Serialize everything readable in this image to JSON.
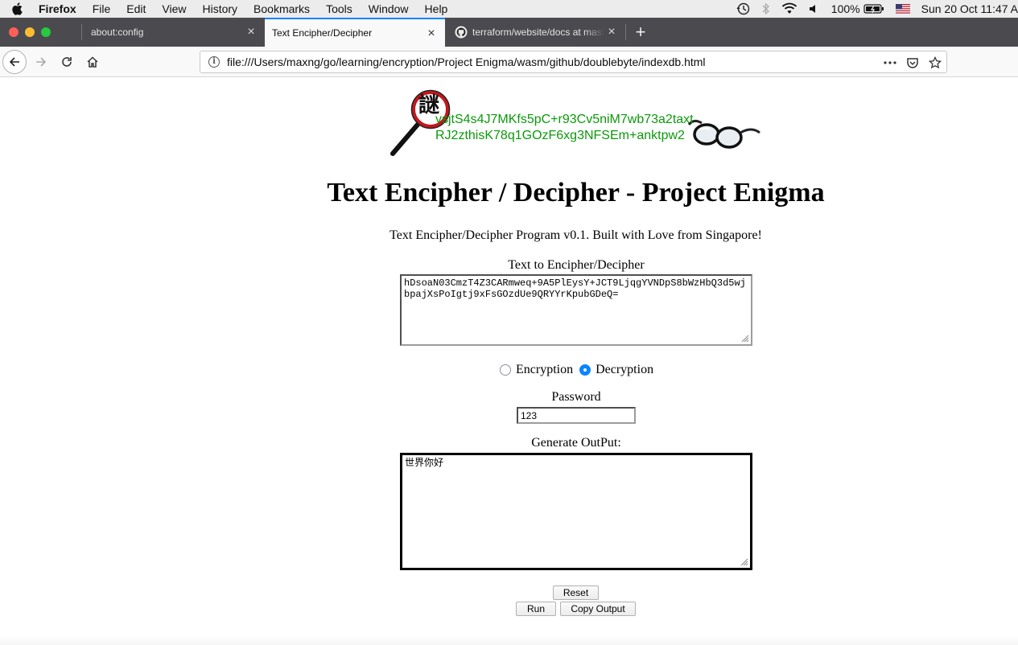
{
  "menubar": {
    "app": "Firefox",
    "items": [
      "File",
      "Edit",
      "View",
      "History",
      "Bookmarks",
      "Tools",
      "Window",
      "Help"
    ],
    "status": {
      "battery": "100%",
      "clock": "Sun 20 Oct  11:47 A"
    }
  },
  "tabs": [
    {
      "label": "about:config",
      "active": false
    },
    {
      "label": "Text Encipher/Decipher",
      "active": true
    },
    {
      "label": "terraform/website/docs at mast",
      "active": false
    }
  ],
  "navbar": {
    "url": "file:///Users/maxng/go/learning/encryption/Project Enigma/wasm/github/doublebyte/indexdb.html"
  },
  "page": {
    "logo_lines": [
      "vsjtS4s4J7MKfs5pC+r93Cv5niM7wb73a2taxt",
      "RJ2zthisK78q1GOzF6xg3NFSEm+anktpw2"
    ],
    "logo_glyph": "謎",
    "title": "Text Encipher / Decipher - Project Enigma",
    "subtitle": "Text Encipher/Decipher Program v0.1. Built with Love from Singapore!",
    "input_label": "Text to Encipher/Decipher",
    "input_value": "hDsoaN03CmzT4Z3CARmweq+9A5PlEysY+JCT9LjqgYVNDpS8bWzHbQ3d5wjbpajXsPoIgtj9xFsGOzdUe9QRYYrKpubGDeQ=",
    "mode": {
      "encryption_label": "Encryption",
      "decryption_label": "Decryption",
      "selected": "Decryption"
    },
    "password_label": "Password",
    "password_value": "123",
    "output_label": "Generate OutPut:",
    "output_value": "世界你好",
    "buttons": {
      "reset": "Reset",
      "run": "Run",
      "copy": "Copy Output"
    }
  },
  "colors": {
    "accent": "#0a84ff",
    "logo_text": "#0b9a0b",
    "tabstrip": "#4a4a4f"
  }
}
